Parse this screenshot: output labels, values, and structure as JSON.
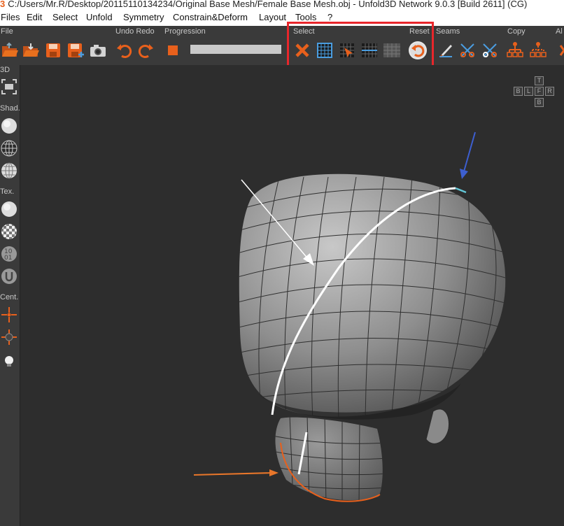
{
  "window": {
    "logo": "3",
    "title": "C:/Users/Mr.R/Desktop/20115110134234/Original Base Mesh/Female Base Mesh.obj - Unfold3D Network 9.0.3 [Build 2611] (CG)"
  },
  "menu": [
    "Files",
    "Edit",
    "Select",
    "Unfold",
    "Symmetry",
    "Constrain&Deform",
    "Layout",
    "Tools",
    "?"
  ],
  "toolbar": {
    "groups": {
      "file": "File",
      "undo_redo": "Undo Redo",
      "progression": "Progression",
      "select": "Select",
      "reset": "Reset",
      "seams": "Seams",
      "copy": "Copy",
      "all": "Al"
    },
    "accent_color": "#e8601c",
    "highlight_color": "#e8262b"
  },
  "sidebar": {
    "labels": {
      "view": "3D",
      "shading": "Shad.",
      "texture": "Tex.",
      "center": "Cent."
    }
  },
  "navcube": {
    "top": "T",
    "back": "B",
    "left": "L",
    "front": "F",
    "right": "R",
    "bottom": "B"
  }
}
